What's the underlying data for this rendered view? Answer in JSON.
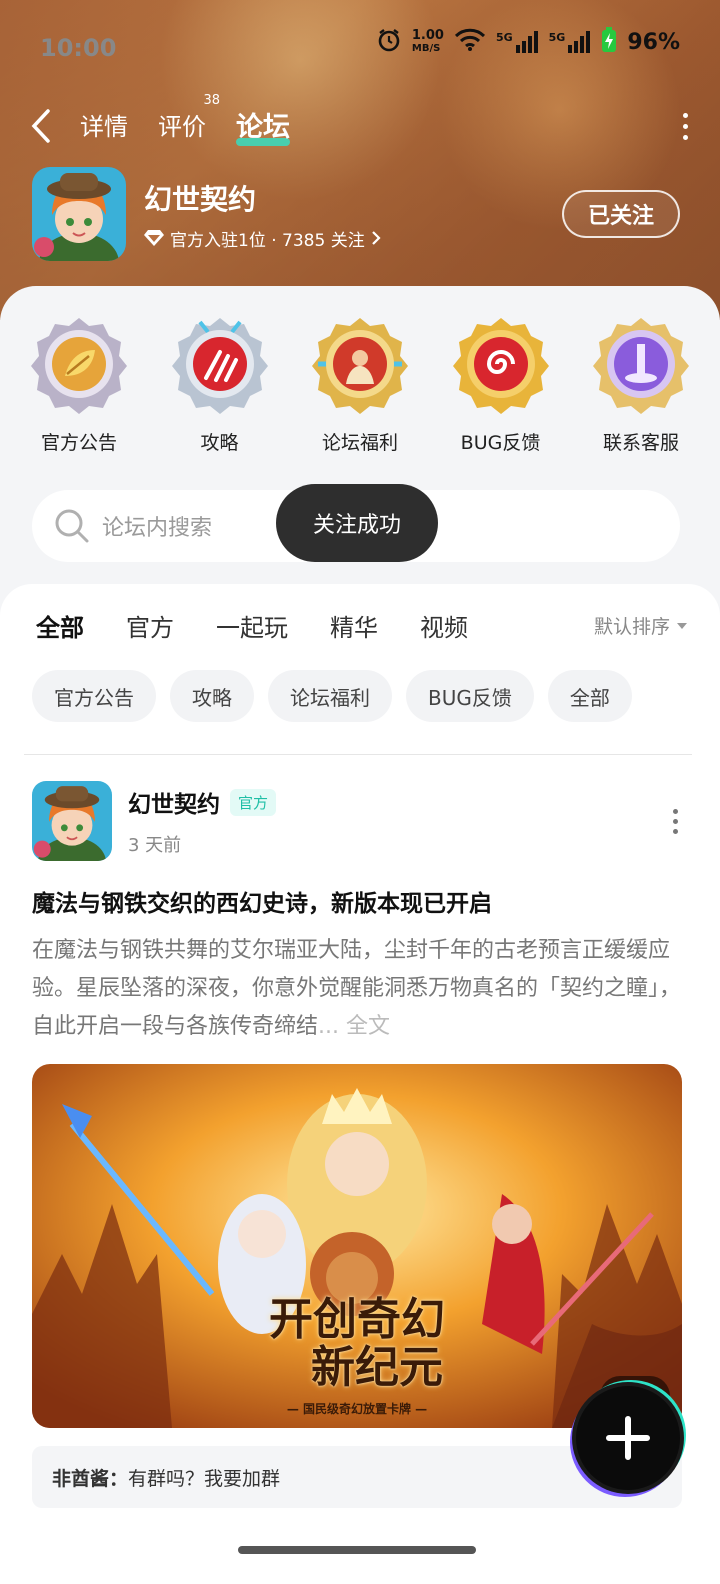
{
  "status_bar": {
    "time": "10:00",
    "net_speed": "1.00\nMB/S",
    "net_speed_top": "1.00",
    "net_speed_unit": "MB/S",
    "sim1": "5G",
    "sim2": "5G",
    "battery": "96%"
  },
  "nav": {
    "tabs": [
      {
        "label": "详情"
      },
      {
        "label": "评价",
        "badge": "38"
      },
      {
        "label": "论坛"
      }
    ]
  },
  "game": {
    "name": "幻世契约",
    "sub": "官方入驻1位 · 7385 关注",
    "follow_label": "已关注"
  },
  "quick_entries": [
    {
      "label": "官方公告",
      "icon": "leaf-badge-icon",
      "color": "#e6a43a"
    },
    {
      "label": "攻略",
      "icon": "claw-badge-icon",
      "color": "#d8262e"
    },
    {
      "label": "论坛福利",
      "icon": "warrior-badge-icon",
      "color": "#d03a2a"
    },
    {
      "label": "BUG反馈",
      "icon": "spiral-badge-icon",
      "color": "#d8262e"
    },
    {
      "label": "联系客服",
      "icon": "portal-badge-icon",
      "color": "#8a5cdc"
    }
  ],
  "search": {
    "placeholder": "论坛内搜索"
  },
  "feed_tabs": [
    "全部",
    "官方",
    "一起玩",
    "精华",
    "视频"
  ],
  "sort_label": "默认排序",
  "chips": [
    "官方公告",
    "攻略",
    "论坛福利",
    "BUG反馈",
    "全部"
  ],
  "toast": "关注成功",
  "post": {
    "author": "幻世契约",
    "badge": "官方",
    "time": "3 天前",
    "title": "魔法与钢铁交织的西幻史诗，新版本现已开启",
    "body": "在魔法与钢铁共舞的艾尔瑞亚大陆，尘封千年的古老预言正缓缓应验。星辰坠落的深夜，你意外觉醒能洞悉万物真名的「契约之瞳」，自此开启一段与各族传奇缔结",
    "fulltext": "... 全文",
    "banner_title_1": "开创奇幻",
    "banner_title_2": "新纪元",
    "banner_sub": "— 国民级奇幻放置卡牌 —",
    "image_count": "2",
    "comment_user": "非酋酱：",
    "comment_text": "有群吗？我要加群"
  }
}
